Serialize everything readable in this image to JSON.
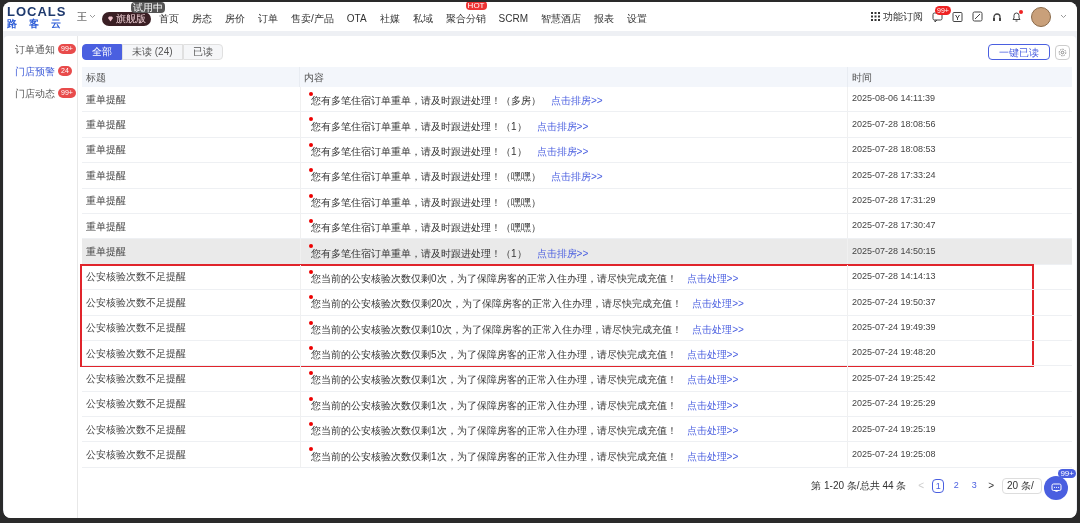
{
  "header": {
    "logo": "LOCALS",
    "logo_subtitle": "路客云",
    "user": "王",
    "plan_badge": "旗舰版",
    "trial_tag": "试用中",
    "nav": [
      {
        "label": "首页"
      },
      {
        "label": "房态"
      },
      {
        "label": "房价"
      },
      {
        "label": "订单"
      },
      {
        "label": "售卖/产品"
      },
      {
        "label": "OTA"
      },
      {
        "label": "社媒"
      },
      {
        "label": "私域"
      },
      {
        "label": "聚合分销",
        "badge": "HOT"
      },
      {
        "label": "SCRM"
      },
      {
        "label": "智慧酒店"
      },
      {
        "label": "报表"
      },
      {
        "label": "设置"
      }
    ],
    "subscribe_button": "功能订阅",
    "message_badge": "99+",
    "notification_dot": true
  },
  "sidebar": {
    "items": [
      {
        "label": "订单通知",
        "count": "99+",
        "selected": false
      },
      {
        "label": "门店预警",
        "count": "24",
        "selected": true
      },
      {
        "label": "门店动态",
        "count": "99+",
        "selected": false
      }
    ]
  },
  "tabs": [
    {
      "label": "全部",
      "selected": true
    },
    {
      "label": "未读 (24)",
      "selected": false
    },
    {
      "label": "已读",
      "selected": false
    }
  ],
  "mark_all_read_button": "一键已读",
  "table": {
    "columns": [
      "标题",
      "内容",
      "时间"
    ],
    "rows": [
      {
        "title": "重单提醒",
        "content": "您有多笔住宿订单重单，请及时跟进处理！（多房）",
        "link": "点击排房>>",
        "time": "2025-08-06 14:11:39",
        "unread": true,
        "hovered": false,
        "highlighted": false
      },
      {
        "title": "重单提醒",
        "content": "您有多笔住宿订单重单，请及时跟进处理！（1）",
        "link": "点击排房>>",
        "time": "2025-07-28 18:08:56",
        "unread": true,
        "hovered": false,
        "highlighted": false
      },
      {
        "title": "重单提醒",
        "content": "您有多笔住宿订单重单，请及时跟进处理！（1）",
        "link": "点击排房>>",
        "time": "2025-07-28 18:08:53",
        "unread": true,
        "hovered": false,
        "highlighted": false
      },
      {
        "title": "重单提醒",
        "content": "您有多笔住宿订单重单，请及时跟进处理！（嘿嘿）",
        "link": "点击排房>>",
        "time": "2025-07-28 17:33:24",
        "unread": true,
        "hovered": false,
        "highlighted": false
      },
      {
        "title": "重单提醒",
        "content": "您有多笔住宿订单重单，请及时跟进处理！（嘿嘿）",
        "time": "2025-07-28 17:31:29",
        "unread": true,
        "hovered": false,
        "highlighted": false
      },
      {
        "title": "重单提醒",
        "content": "您有多笔住宿订单重单，请及时跟进处理！（嘿嘿）",
        "time": "2025-07-28 17:30:47",
        "unread": true,
        "hovered": false,
        "highlighted": false
      },
      {
        "title": "重单提醒",
        "content": "您有多笔住宿订单重单，请及时跟进处理！（1）",
        "link": "点击排房>>",
        "time": "2025-07-28 14:50:15",
        "unread": true,
        "hovered": true,
        "highlighted": false
      },
      {
        "title": "公安核验次数不足提醒",
        "content": "您当前的公安核验次数仅剩0次，为了保障房客的正常入住办理，请尽快完成充值！",
        "link": "点击处理>>",
        "time": "2025-07-28 14:14:13",
        "unread": true,
        "hovered": false,
        "highlighted": true
      },
      {
        "title": "公安核验次数不足提醒",
        "content": "您当前的公安核验次数仅剩20次，为了保障房客的正常入住办理，请尽快完成充值！",
        "link": "点击处理>>",
        "time": "2025-07-24 19:50:37",
        "unread": true,
        "hovered": false,
        "highlighted": true
      },
      {
        "title": "公安核验次数不足提醒",
        "content": "您当前的公安核验次数仅剩10次，为了保障房客的正常入住办理，请尽快完成充值！",
        "link": "点击处理>>",
        "time": "2025-07-24 19:49:39",
        "unread": true,
        "hovered": false,
        "highlighted": true
      },
      {
        "title": "公安核验次数不足提醒",
        "content": "您当前的公安核验次数仅剩5次，为了保障房客的正常入住办理，请尽快完成充值！",
        "link": "点击处理>>",
        "time": "2025-07-24 19:48:20",
        "unread": true,
        "hovered": false,
        "highlighted": true
      },
      {
        "title": "公安核验次数不足提醒",
        "content": "您当前的公安核验次数仅剩1次，为了保障房客的正常入住办理，请尽快完成充值！",
        "link": "点击处理>>",
        "time": "2025-07-24 19:25:42",
        "unread": true,
        "hovered": false,
        "highlighted": false
      },
      {
        "title": "公安核验次数不足提醒",
        "content": "您当前的公安核验次数仅剩1次，为了保障房客的正常入住办理，请尽快完成充值！",
        "link": "点击处理>>",
        "time": "2025-07-24 19:25:29",
        "unread": true,
        "hovered": false,
        "highlighted": false
      },
      {
        "title": "公安核验次数不足提醒",
        "content": "您当前的公安核验次数仅剩1次，为了保障房客的正常入住办理，请尽快完成充值！",
        "link": "点击处理>>",
        "time": "2025-07-24 19:25:19",
        "unread": true,
        "hovered": false,
        "highlighted": false
      },
      {
        "title": "公安核验次数不足提醒",
        "content": "您当前的公安核验次数仅剩1次，为了保障房客的正常入住办理，请尽快完成充值！",
        "link": "点击处理>>",
        "time": "2025-07-24 19:25:08",
        "unread": true,
        "hovered": false,
        "highlighted": false
      }
    ]
  },
  "pagination": {
    "summary": "第 1-20 条/总共 44 条",
    "prev": "<",
    "next": ">",
    "prev_disabled": true,
    "pages": [
      {
        "label": "1",
        "selected": true
      },
      {
        "label": "2",
        "selected": false
      },
      {
        "label": "3",
        "selected": false
      }
    ],
    "page_size": "20 条/"
  },
  "chat_button": {
    "badge": "99+"
  }
}
